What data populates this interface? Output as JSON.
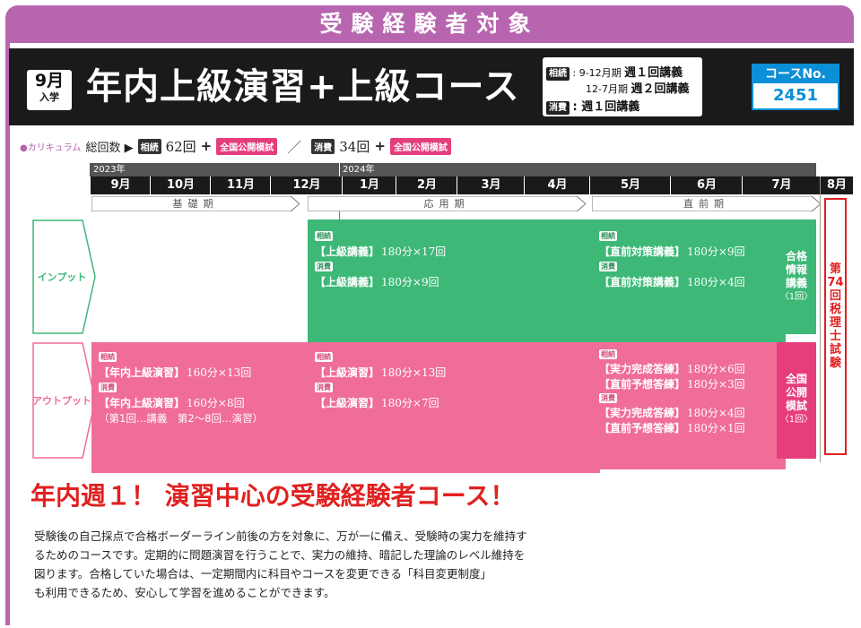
{
  "banner": {
    "title": "受験経験者対象"
  },
  "header": {
    "entry_month": "9月",
    "entry_sub": "入学",
    "course_title": "年内上級演習+上級コース",
    "schedule": {
      "tag1": "相続",
      "line1_period": ": 9-12月期",
      "line1_value": "週１回講義",
      "line2_period": "12-7月期",
      "line2_value": "週２回講義",
      "tag2": "消費",
      "line3_value": ": 週１回講義"
    },
    "course_no_label": "コースNo.",
    "course_no": "2451"
  },
  "curriculum": {
    "label": "●カリキュラム",
    "prefix": "総回数 ▶",
    "tag1": "相続",
    "count1": "62回",
    "plus1": "+",
    "pill1": "全国公開模試",
    "slash": "／",
    "tag2": "消費",
    "count2": "34回",
    "plus2": "+",
    "pill2": "全国公開模試"
  },
  "timeline": {
    "years": [
      "2023年",
      "2024年"
    ],
    "months": [
      "9月",
      "10月",
      "11月",
      "12月",
      "1月",
      "2月",
      "3月",
      "4月",
      "5月",
      "6月",
      "7月",
      "8月"
    ],
    "phases": [
      "基礎期",
      "応用期",
      "直前期"
    ]
  },
  "rows": {
    "input_label": "インプット",
    "output_label": "アウトプット"
  },
  "blocks": {
    "input_mid": {
      "tag1": "相続",
      "name1": "【上級講義】",
      "dur1": "180分×17回",
      "tag2": "消費",
      "name2": "【上級講義】",
      "dur2": "180分×9回"
    },
    "input_late": {
      "tag1": "相続",
      "name1": "【直前対策講義】",
      "dur1": "180分×9回",
      "tag2": "消費",
      "name2": "【直前対策講義】",
      "dur2": "180分×4回"
    },
    "input_side": {
      "l1": "合格",
      "l2": "情報",
      "l3": "講義",
      "l4": "〈1回〉"
    },
    "output_early": {
      "tag1": "相続",
      "name1": "【年内上級演習】",
      "dur1": "160分×13回",
      "tag2": "消費",
      "name2": "【年内上級演習】",
      "dur2": "160分×8回",
      "note": "（第1回…講義　第2～8回…演習）"
    },
    "output_mid": {
      "tag1": "相続",
      "name1": "【上級演習】",
      "dur1": "180分×13回",
      "tag2": "消費",
      "name2": "【上級演習】",
      "dur2": "180分×7回"
    },
    "output_late": {
      "tag1": "相続",
      "name1": "【実力完成答練】",
      "dur1": "180分×6回",
      "name2": "【直前予想答練】",
      "dur2": "180分×3回",
      "tag2": "消費",
      "name3": "【実力完成答練】",
      "dur3": "180分×4回",
      "name4": "【直前予想答練】",
      "dur4": "180分×1回"
    },
    "output_side": {
      "l1": "全国",
      "l2": "公開",
      "l3": "模試",
      "l4": "〈1回〉"
    },
    "exam": [
      "第",
      "74",
      "回",
      "税",
      "理",
      "士",
      "試",
      "験"
    ]
  },
  "headline": "年内週１！ 演習中心の受験経験者コース！",
  "body": [
    "受験後の自己採点で合格ボーダーライン前後の方を対象に、万が一に備え、受験時の実力を維持す",
    "るためのコースです。定期的に問題演習を行うことで、実力の維持、暗記した理論のレベル維持を",
    "図ります。合格していた場合は、一定期間内に科目やコースを変更できる「科目変更制度」",
    "も利用できるため、安心して学習を進めることができます。"
  ],
  "colors": {
    "purple": "#b865b0",
    "green": "#3db877",
    "pink": "#ef6d97",
    "red": "#e02020",
    "blue": "#0b8fd6"
  }
}
